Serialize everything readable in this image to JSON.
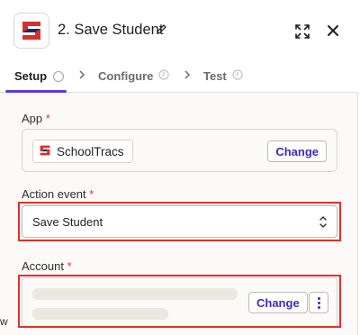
{
  "header": {
    "title": "2. Save Student"
  },
  "tabs": [
    {
      "label": "Setup",
      "active": true
    },
    {
      "label": "Configure",
      "active": false
    },
    {
      "label": "Test",
      "active": false
    }
  ],
  "app_field": {
    "label": "App",
    "required_marker": "*",
    "app_name": "SchoolTracs",
    "change_label": "Change"
  },
  "action_event_field": {
    "label": "Action event",
    "required_marker": "*",
    "value": "Save Student"
  },
  "account_field": {
    "label": "Account",
    "required_marker": "*",
    "change_label": "Change"
  },
  "edge_text": "w",
  "colors": {
    "accent": "#3b2bbd",
    "tab_underline": "#5a3dd8",
    "highlight": "#e03228",
    "required": "#d8392b",
    "logo_red": "#d9302c",
    "logo_navy": "#1c2e63"
  }
}
